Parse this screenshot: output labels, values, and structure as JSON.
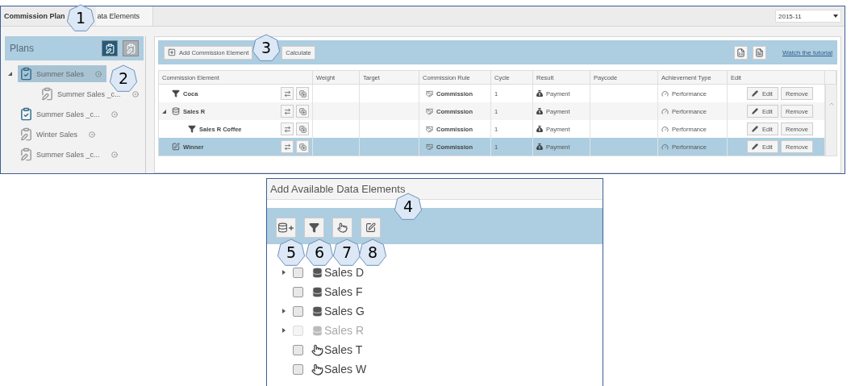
{
  "tabs": [
    {
      "label": "Commission Plan",
      "selected": true
    },
    {
      "label": "ata Elements",
      "selected": false
    }
  ],
  "period": {
    "value": "2015-11"
  },
  "plans": {
    "title": "Plans",
    "items": [
      {
        "label": "Summer Sales",
        "kind": "approved",
        "selected": true,
        "expanded": true,
        "children": [
          {
            "label": "Summer Sales _c...",
            "kind": "draft",
            "selected": false
          }
        ]
      },
      {
        "label": "Summer Sales _c...",
        "kind": "approved",
        "selected": false
      },
      {
        "label": "Winter Sales",
        "kind": "draft",
        "selected": false
      },
      {
        "label": "Summer Sales _c...",
        "kind": "draft",
        "selected": false
      }
    ]
  },
  "toolbar": {
    "buttons": [
      "Add Commission Element",
      "Calculate"
    ],
    "link": "Watch the tutorial"
  },
  "table": {
    "columns": [
      "Commission Element",
      "Weight",
      "Target",
      "Commission Rule",
      "Cycle",
      "Result",
      "Paycode",
      "Achievement Type",
      "Edit"
    ],
    "rows": [
      {
        "name": "Coca",
        "kind": "filter",
        "selected": false,
        "rule": "Commission",
        "cycle": "1",
        "result": "Payment",
        "achievement": "Performance",
        "actions": [
          "Edit",
          "Remove"
        ]
      },
      {
        "name": "Sales R",
        "kind": "database",
        "selected": false,
        "expanded": true,
        "rule": "Commission",
        "cycle": "1",
        "result": "Payment",
        "achievement": "Performance",
        "actions": [
          "Edit",
          "Remove"
        ],
        "children": [
          {
            "name": "Sales R Coffee",
            "kind": "filter",
            "selected": false,
            "rule": "Commission",
            "cycle": "1",
            "result": "Payment",
            "achievement": "Performance",
            "actions": [
              "Edit",
              "Remove"
            ]
          }
        ]
      },
      {
        "name": "Winner",
        "kind": "formula",
        "selected": true,
        "rule": "Commission",
        "cycle": "1",
        "result": "Payment",
        "achievement": "Performance",
        "actions": [
          "Edit",
          "Remove"
        ]
      }
    ]
  },
  "dialog": {
    "title": "Add Available Data Elements",
    "items": [
      {
        "label": "Sales D",
        "kind": "database",
        "expandable": true,
        "checked": false,
        "disabled": false
      },
      {
        "label": "Sales F",
        "kind": "database",
        "expandable": false,
        "checked": false,
        "disabled": false
      },
      {
        "label": "Sales G",
        "kind": "database",
        "expandable": true,
        "checked": false,
        "disabled": false
      },
      {
        "label": "Sales R",
        "kind": "database",
        "expandable": true,
        "checked": false,
        "disabled": true
      },
      {
        "label": "Sales T",
        "kind": "touch",
        "expandable": false,
        "checked": false,
        "disabled": false
      },
      {
        "label": "Sales W",
        "kind": "touch",
        "expandable": false,
        "checked": false,
        "disabled": false
      }
    ]
  },
  "callouts": [
    "1",
    "2",
    "3",
    "4",
    "5",
    "6",
    "7",
    "8"
  ]
}
